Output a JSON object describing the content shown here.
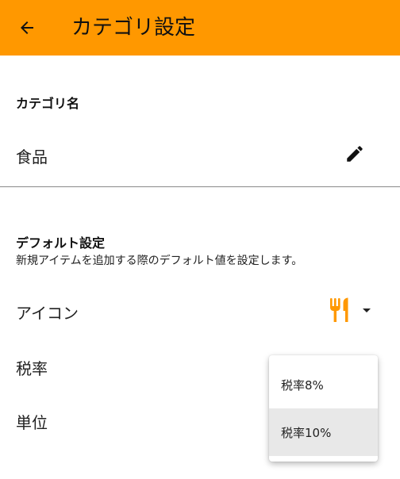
{
  "appbar": {
    "title": "カテゴリ設定",
    "back_icon": "arrow-back-icon",
    "color": "#ff9800"
  },
  "category": {
    "label": "カテゴリ名",
    "name": "食品",
    "edit_icon": "pencil-icon"
  },
  "defaults": {
    "heading": "デフォルト設定",
    "description": "新規アイテムを追加する際のデフォルト値を設定します。",
    "icon_row": {
      "label": "アイコン",
      "selected_icon": "fork-knife-icon",
      "icon_color": "#ff9800",
      "dropdown_icon": "dropdown-arrow-icon"
    },
    "tax_row": {
      "label": "税率"
    },
    "unit_row": {
      "label": "単位"
    }
  },
  "tax_menu": {
    "options": [
      "税率8%",
      "税率10%"
    ],
    "selected_index": 1
  }
}
